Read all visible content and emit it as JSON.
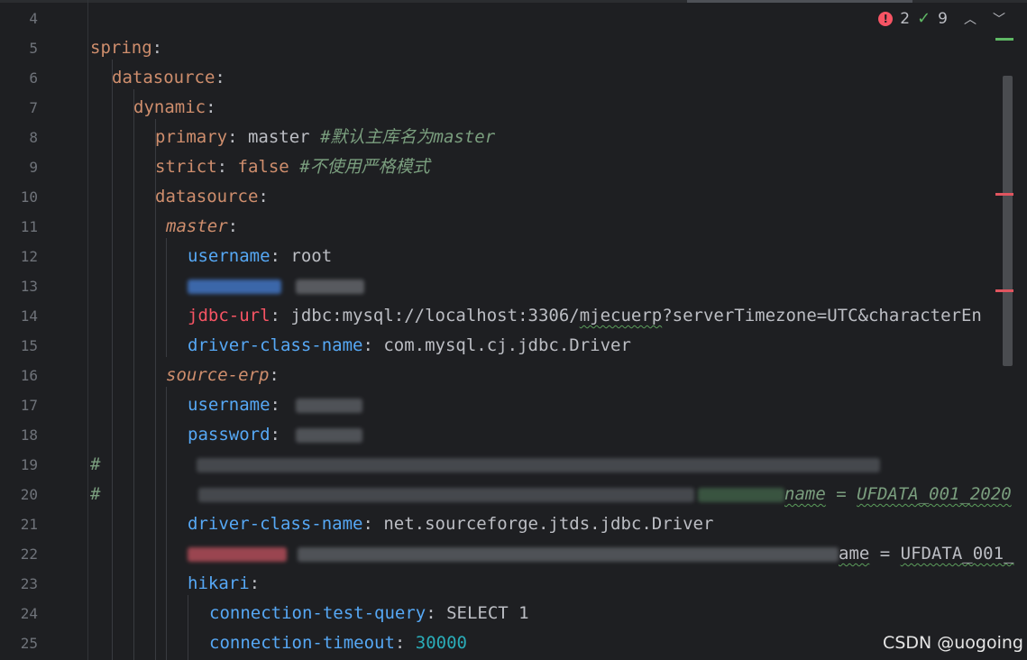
{
  "inspection": {
    "errors": "2",
    "warnings": "9",
    "error_icon": "error-circle-icon",
    "warning_icon": "double-check-icon"
  },
  "lines": [
    {
      "n": "4"
    },
    {
      "n": "5",
      "key": "spring",
      "colon": ":"
    },
    {
      "n": "6",
      "key": "datasource",
      "colon": ":"
    },
    {
      "n": "7",
      "key": "dynamic",
      "colon": ":"
    },
    {
      "n": "8",
      "key": "primary",
      "colon": ": ",
      "value": "master",
      "comment": "#默认主库名为master"
    },
    {
      "n": "9",
      "key": "strict",
      "colon": ": ",
      "value": "false",
      "comment": "#不使用严格模式"
    },
    {
      "n": "10",
      "key": "datasource",
      "colon": ":"
    },
    {
      "n": "11",
      "key": "master",
      "colon": ":"
    },
    {
      "n": "12",
      "key": "username",
      "colon": ": ",
      "value": "root"
    },
    {
      "n": "13"
    },
    {
      "n": "14",
      "key": "jdbc-url",
      "colon": ": ",
      "value_a": "jdbc:mysql://localhost:3306/",
      "value_b": "mjecuerp",
      "value_c": "?serverTimezone=UTC&characterEn"
    },
    {
      "n": "15",
      "key": "driver-class-name",
      "colon": ": ",
      "value": "com.mysql.cj.jdbc.Driver"
    },
    {
      "n": "16",
      "key": "source-erp",
      "colon": ":"
    },
    {
      "n": "17",
      "key": "username",
      "colon": ": "
    },
    {
      "n": "18",
      "key": "password",
      "colon": ": "
    },
    {
      "n": "19",
      "hash": "#"
    },
    {
      "n": "20",
      "hash": "#",
      "tail_a": "name",
      "tail_b": " = ",
      "tail_c": "UFDATA_001_2020"
    },
    {
      "n": "21",
      "key": "driver-class-name",
      "colon": ": ",
      "value": "net.sourceforge.jtds.jdbc.Driver"
    },
    {
      "n": "22",
      "tail_a": "ame",
      "tail_b": " = ",
      "tail_c": "UFDATA_001_"
    },
    {
      "n": "23",
      "key": "hikari",
      "colon": ":"
    },
    {
      "n": "24",
      "key": "connection-test-query",
      "colon": ": ",
      "value": "SELECT 1"
    },
    {
      "n": "25",
      "key": "connection-timeout",
      "colon": ": ",
      "value": "30000"
    }
  ],
  "watermark": "CSDN @uogoing",
  "colors": {
    "key_orange": "#cf8e6d",
    "key_blue": "#56a8f5",
    "comment": "#7a9e7e",
    "number": "#2aacb8",
    "error": "#f75464"
  }
}
